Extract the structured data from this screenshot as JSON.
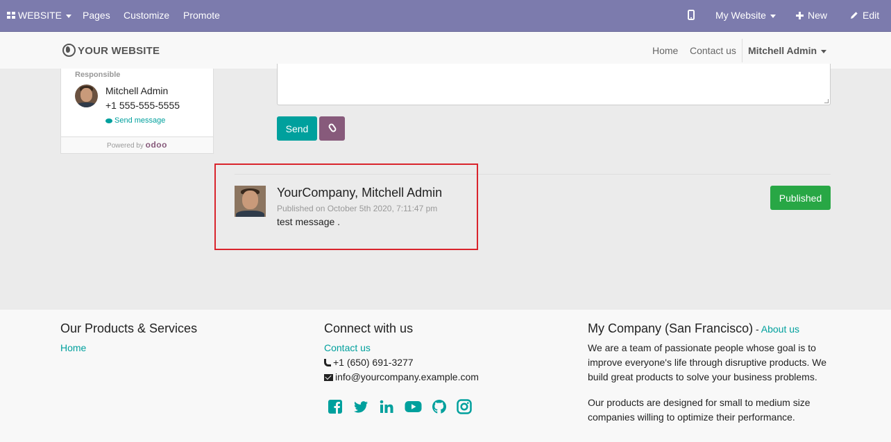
{
  "admin_bar": {
    "website_menu": "WEBSITE",
    "pages": "Pages",
    "customize": "Customize",
    "promote": "Promote",
    "my_website": "My Website",
    "new": "New",
    "edit": "Edit"
  },
  "navbar": {
    "logo": "YOUR WEBSITE",
    "home": "Home",
    "contact": "Contact us",
    "user": "Mitchell Admin"
  },
  "responsible_card": {
    "label": "Responsible",
    "name": "Mitchell Admin",
    "phone": "+1 555-555-5555",
    "send_message": "Send message",
    "powered_by": "Powered by",
    "brand": "odoo"
  },
  "composer": {
    "send": "Send"
  },
  "message": {
    "author": "YourCompany, Mitchell Admin",
    "date": "Published on October 5th 2020, 7:11:47 pm",
    "body": "test message .",
    "status": "Published"
  },
  "footer": {
    "products": {
      "title": "Our Products & Services",
      "home": "Home"
    },
    "connect": {
      "title": "Connect with us",
      "contact": "Contact us",
      "phone": "+1 (650) 691-3277",
      "email": "info@yourcompany.example.com",
      "social_icons": [
        "facebook-icon",
        "twitter-icon",
        "linkedin-icon",
        "youtube-icon",
        "github-icon",
        "instagram-icon"
      ]
    },
    "company": {
      "title": "My Company (San Francisco)",
      "separator": " - ",
      "about": "About us",
      "para1": "We are a team of passionate people whose goal is to improve everyone's life through disruptive products. We build great products to solve your business problems.",
      "para2": "Our products are designed for small to medium size companies willing to optimize their performance."
    }
  },
  "colors": {
    "admin_bar": "#7c7bad",
    "primary": "#00a09d",
    "attach": "#875a7b",
    "published": "#28a745",
    "highlight": "#d9232b"
  }
}
